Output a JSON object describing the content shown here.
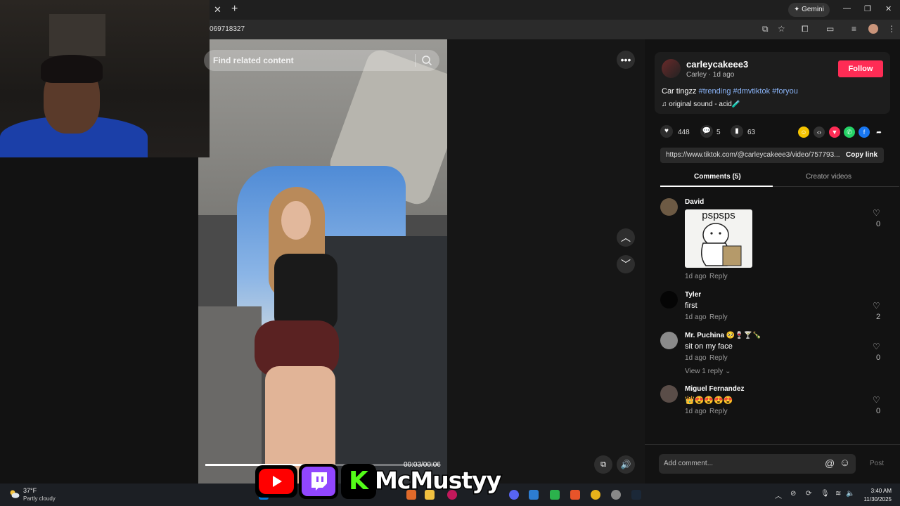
{
  "browser": {
    "close_tab": "✕",
    "new_tab": "+",
    "gemini_label": "✦ Gemini",
    "win_minimize": "—",
    "win_restore": "❐",
    "win_close": "✕",
    "url": "069718327"
  },
  "video": {
    "search_placeholder": "Find related content",
    "time": "00:03/00:06",
    "progress": 0.5
  },
  "post": {
    "author": "carleycakeee3",
    "author_sub": "Carley · 1d ago",
    "follow_label": "Follow",
    "caption_text": "Car tingzz",
    "hashtags": [
      "#trending",
      "#dmvtiktok",
      "#foryou"
    ],
    "sound": "original sound - acid🧪",
    "likes": "448",
    "comments": "5",
    "saves": "63",
    "link": "https://www.tiktok.com/@carleycakeee3/video/757793...",
    "copy_link_label": "Copy link"
  },
  "tabs": {
    "comments": "Comments (5)",
    "creator_videos": "Creator videos"
  },
  "comments": [
    {
      "name": "David",
      "text": "",
      "sticker": "pspsps",
      "time": "1d ago",
      "reply": "Reply",
      "likes": "0"
    },
    {
      "name": "Tyler",
      "text": "first",
      "time": "1d ago",
      "reply": "Reply",
      "likes": "2"
    },
    {
      "name": "Mr. Puchina 🥺🍷🍸🍾",
      "text": "sit on my face",
      "time": "1d ago",
      "reply": "Reply",
      "likes": "0",
      "view_replies": "View 1 reply ⌄"
    },
    {
      "name": "Miguel Fernandez",
      "text": "👑😍😍😍😍",
      "time": "1d ago",
      "reply": "Reply",
      "likes": "0"
    }
  ],
  "comment_box": {
    "placeholder": "Add comment...",
    "post_label": "Post"
  },
  "taskbar": {
    "temp": "37°F",
    "weather": "Partly cloudy",
    "time": "3:40 AM",
    "date": "11/30/2025"
  },
  "brand": {
    "name": "McMustyy"
  }
}
